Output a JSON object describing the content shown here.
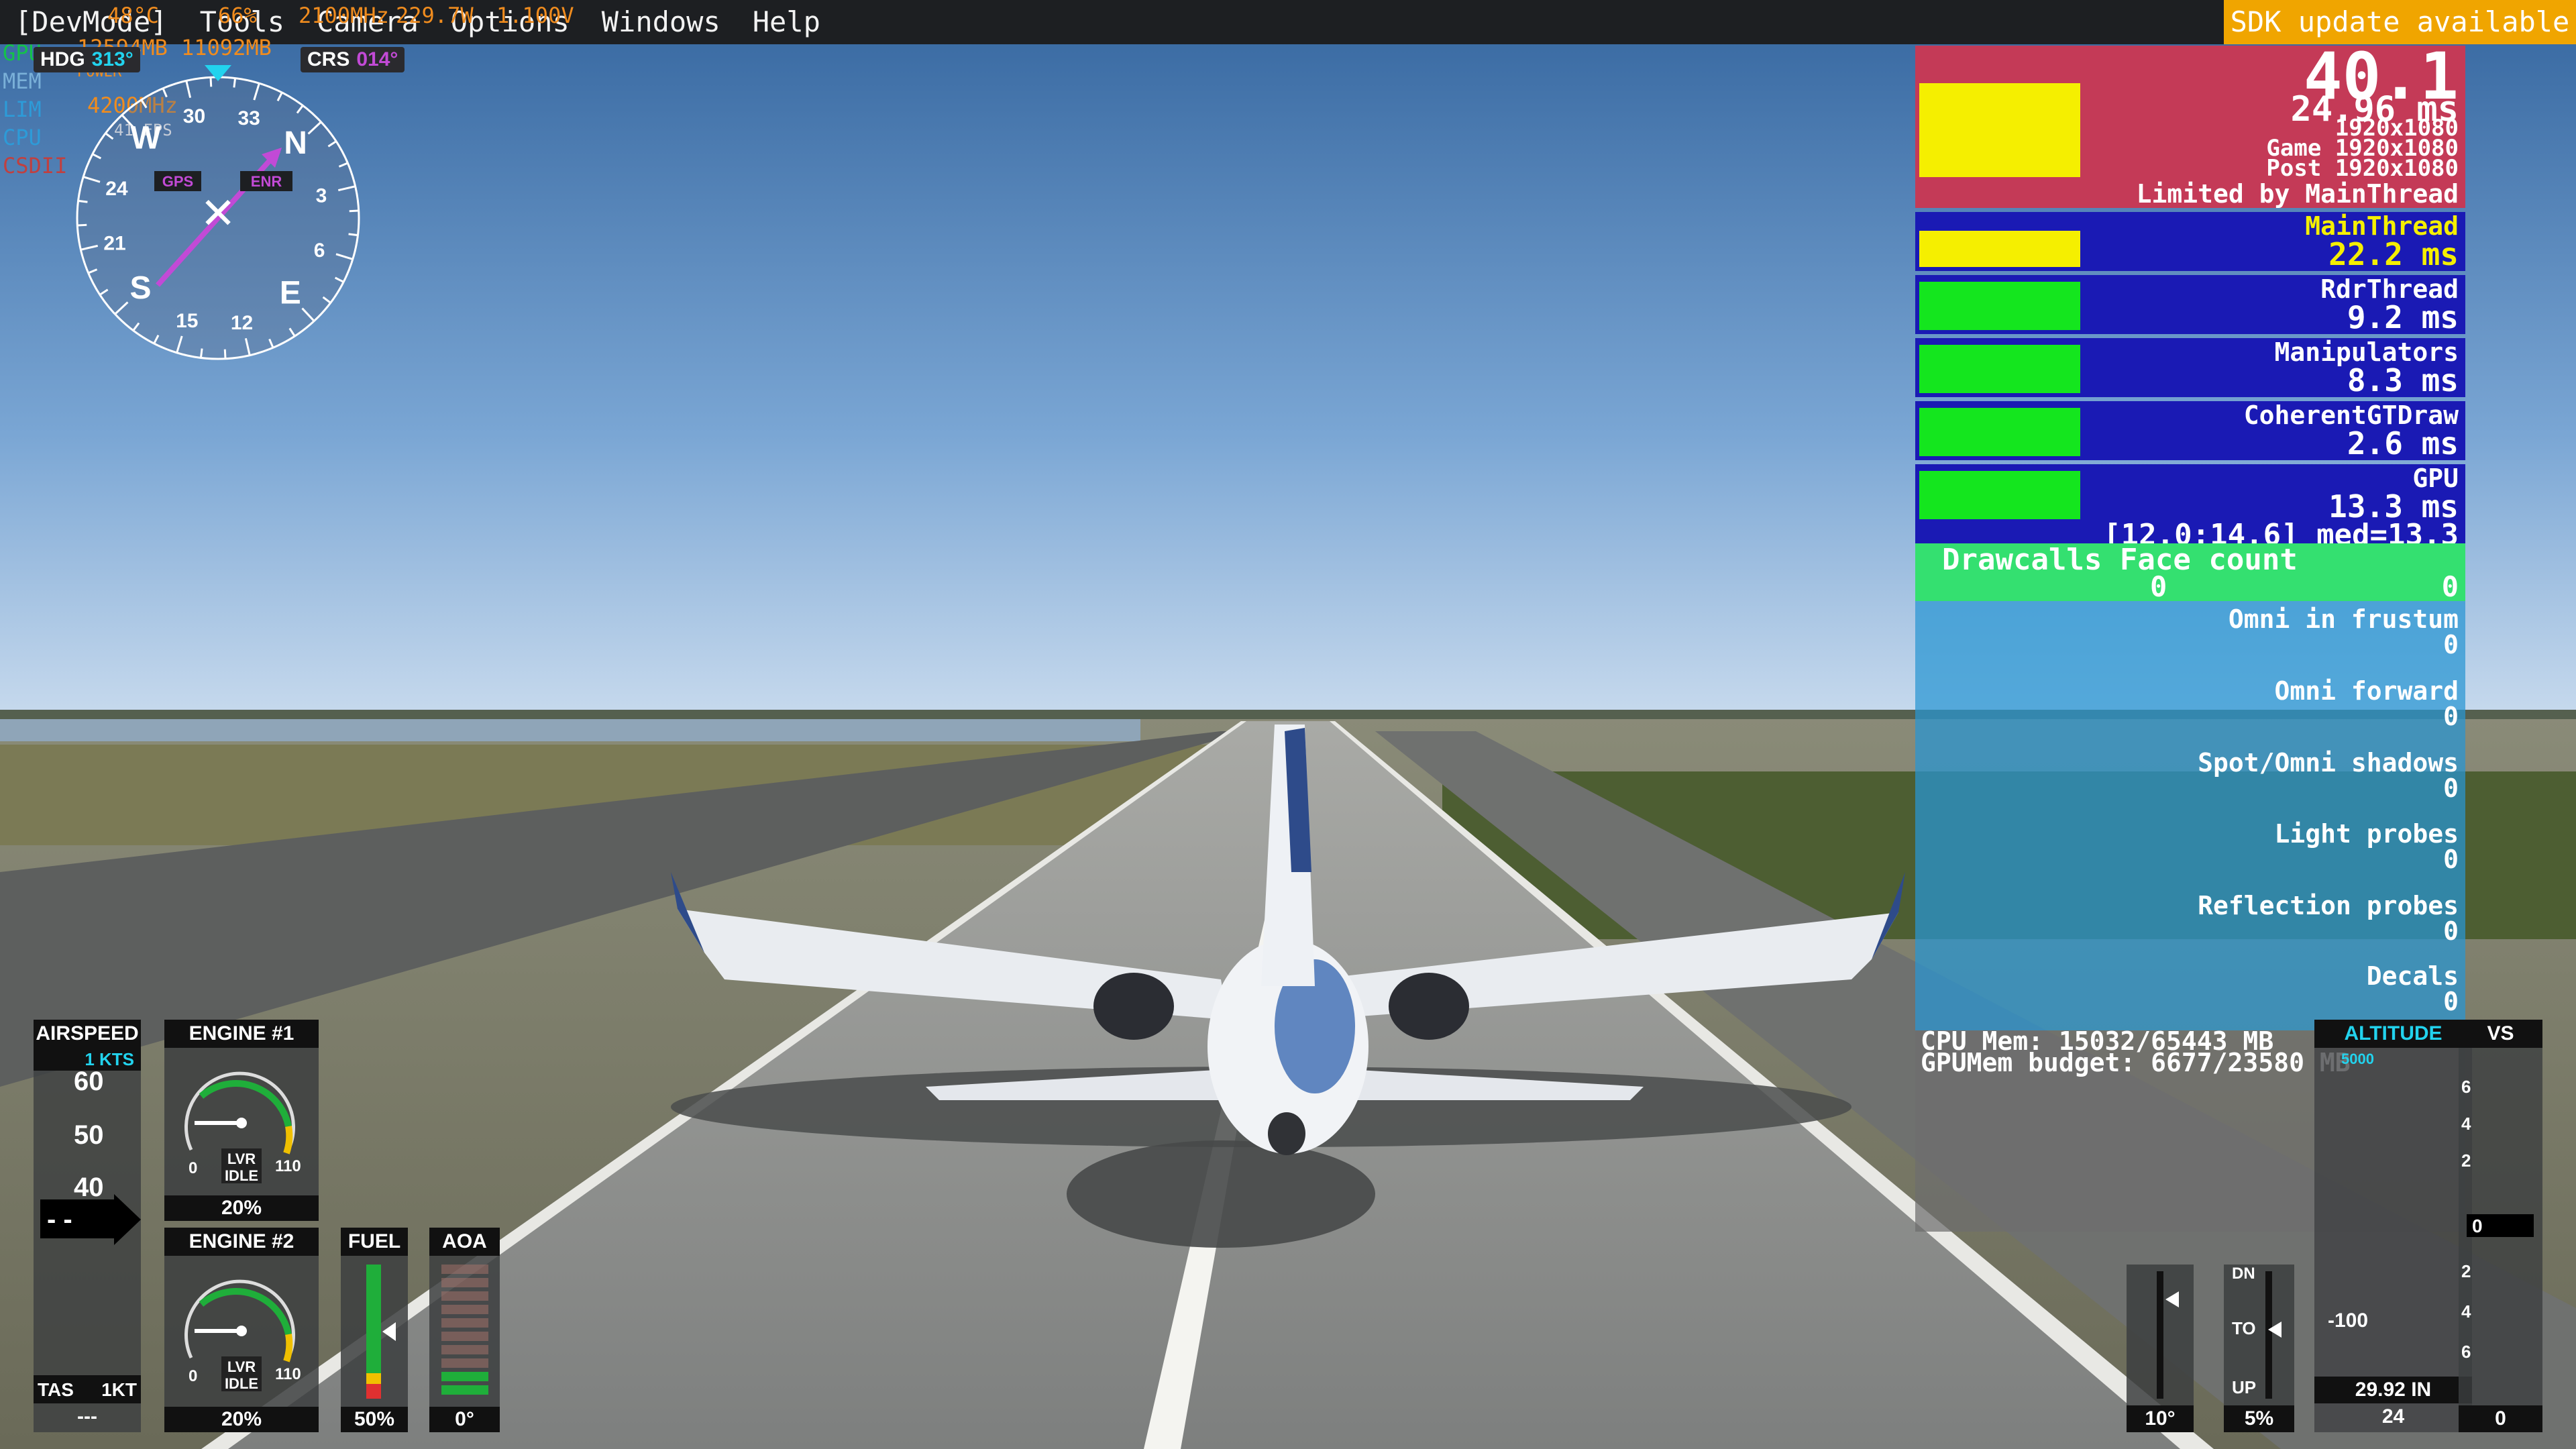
{
  "menu": {
    "items": [
      "[DevMode]",
      "Tools",
      "Camera",
      "Options",
      "Windows",
      "Help"
    ],
    "sdk_banner": "SDK update available"
  },
  "system_stats": {
    "labels": [
      "GPU",
      "MEM",
      "LIM",
      "CPU",
      "CSDII"
    ],
    "gpu_temp": "48°C",
    "gpu_load": "66%",
    "gpu_clock": "2100MHz",
    "gpu_power": "229.7W",
    "gpu_volt": "1.100V",
    "mem_used": "12594MB",
    "mem_vram": "11092MB",
    "lim": "POWER",
    "cpu_clock": "4200MHz",
    "fps": "41 FPS"
  },
  "nav": {
    "hdg_label": "HDG",
    "hdg_value": "313°",
    "crs_label": "CRS",
    "crs_value": "014°",
    "gps_badge": "GPS",
    "enr_badge": "ENR",
    "compass_labels": [
      "N",
      "3",
      "6",
      "E",
      "12",
      "15",
      "S",
      "21",
      "24",
      "W",
      "30",
      "33"
    ]
  },
  "perf": {
    "fps": "40.1",
    "frame_ms": "24.96 ms",
    "resolution": "1920x1080",
    "game_res": "Game 1920x1080",
    "post_res": "Post 1920x1080",
    "limited_by": "Limited by MainThread",
    "threads": [
      {
        "name": "MainThread",
        "value": "22.2 ms"
      },
      {
        "name": "RdrThread",
        "value": "9.2 ms"
      },
      {
        "name": "Manipulators",
        "value": "8.3 ms"
      },
      {
        "name": "CoherentGTDraw",
        "value": "2.6 ms"
      },
      {
        "name": "GPU",
        "value": "13.3 ms"
      }
    ],
    "gpu_range": "[12.0;14.6] med=13.3",
    "drawcalls_header": "Drawcalls Face count",
    "drawcalls": "0",
    "face_count": "0",
    "lights": [
      {
        "name": "Omni in frustum",
        "value": "0"
      },
      {
        "name": "Omni forward",
        "value": "0"
      },
      {
        "name": "Spot/Omni shadows",
        "value": "0"
      },
      {
        "name": "Light probes",
        "value": "0"
      },
      {
        "name": "Reflection probes",
        "value": "0"
      },
      {
        "name": "Decals",
        "value": "0"
      }
    ],
    "cpu_mem": "CPU Mem: 15032/65443 MB",
    "gpu_mem": "GPUMem budget: 6677/23580 MB"
  },
  "airspeed": {
    "title": "AIRSPEED",
    "kts": "1 KTS",
    "ticks": [
      "60",
      "50",
      "40"
    ],
    "current": "- -",
    "tas_label": "TAS",
    "tas_value": "1KT",
    "bottom": "---"
  },
  "engines": [
    {
      "title": "ENGINE #1",
      "percent": "20%",
      "lvr": "LVR",
      "idle": "IDLE",
      "min": "0",
      "max": "110"
    },
    {
      "title": "ENGINE #2",
      "percent": "20%",
      "lvr": "LVR",
      "idle": "IDLE",
      "min": "0",
      "max": "110"
    }
  ],
  "fuel": {
    "title": "FUEL",
    "value": "50%",
    "level": 0.5
  },
  "aoa": {
    "title": "AOA",
    "value": "0°"
  },
  "altitude": {
    "title": "ALTITUDE",
    "tick": "5000",
    "minus100": "-100",
    "baro": "29.92 IN",
    "bottom": "24"
  },
  "vs": {
    "title": "VS",
    "ticks": [
      "6",
      "4",
      "2",
      "0",
      "2",
      "4",
      "6"
    ],
    "current": "0",
    "bottom": "0"
  },
  "trim": {
    "value": "10°"
  },
  "flaps": {
    "dn": "DN",
    "to": "TO",
    "up": "UP",
    "value": "5%"
  },
  "colors": {
    "sky_top": "#3a6aa8",
    "sky_horizon": "#bcd3ea",
    "accent_cyan": "#22d3ee",
    "accent_magenta": "#c24ad6",
    "perf_red": "#c43a57",
    "perf_blue": "#1a1ab4",
    "perf_green": "#14e61e",
    "perf_yellow": "#f5ef00"
  }
}
